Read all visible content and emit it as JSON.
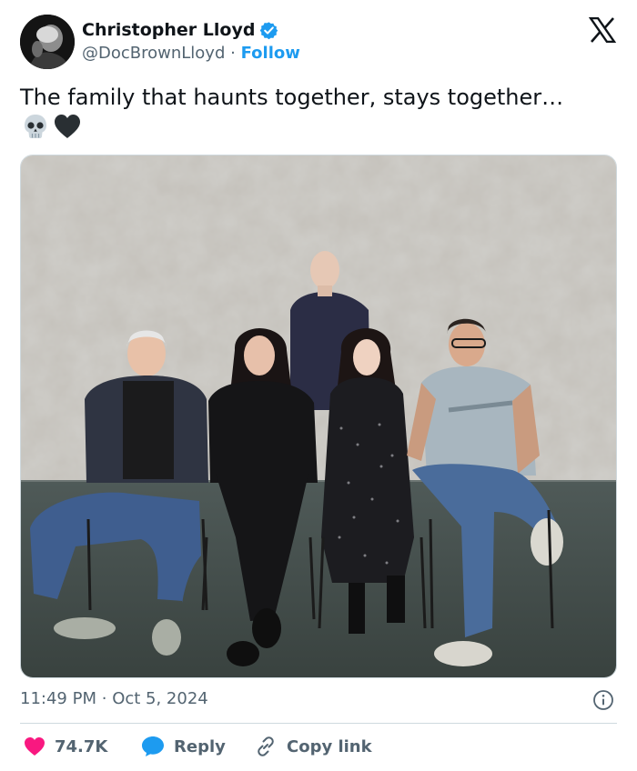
{
  "author": {
    "display_name": "Christopher Lloyd",
    "handle": "@DocBrownLloyd",
    "separator": "·",
    "follow_label": "Follow",
    "verified_icon": "verified-badge-icon",
    "brand_color": "#1d9bf0"
  },
  "tweet": {
    "text": "The family that haunts together, stays together…",
    "emojis": [
      "skull-icon",
      "black-heart-icon"
    ],
    "photo_alt": "Five people seated and standing in front of a grey mottled backdrop"
  },
  "meta": {
    "time": "11:49 PM",
    "separator": "·",
    "date": "Oct 5, 2024"
  },
  "actions": {
    "likes": "74.7K",
    "reply_label": "Reply",
    "copy_label": "Copy link",
    "like_color": "#f91880",
    "reply_color": "#1d9bf0"
  },
  "icons": {
    "platform_logo": "x-logo-icon",
    "info": "info-icon"
  }
}
